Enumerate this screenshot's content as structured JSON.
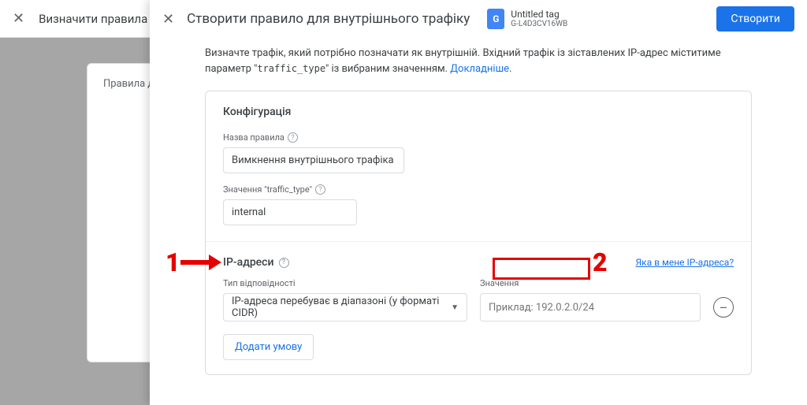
{
  "bg": {
    "close": "✕",
    "title": "Визначити правила д",
    "card_text": "Правила дл"
  },
  "panel": {
    "close": "✕",
    "title": "Створити правило для внутрішнього трафіку",
    "tag_letter": "G",
    "tag_name": "Untitled tag",
    "tag_id": "G-L4D3CV16WB",
    "create": "Створити"
  },
  "desc": {
    "text1": "Визначте трафік, який потрібно позначати як внутрішній. Вхідний трафік із зіставлених IP-адрес міститиме параметр \"",
    "code": "traffic_type",
    "text2": "\" із вибраним значенням. ",
    "link": "Докладніше"
  },
  "card": {
    "config": "Конфігурація",
    "rule_name_label": "Назва правила",
    "rule_name_value": "Вимкнення внутрішнього трафіка",
    "traffic_label": "Значення \"traffic_type\"",
    "traffic_value": "internal",
    "ip_title": "IP-адреси",
    "ip_link": "Яка в мене IP-адреса?",
    "match_label": "Тип відповідності",
    "match_value": "IP-адреса перебуває в діапазоні (у форматі CIDR)",
    "value_label": "Значення",
    "value_placeholder": "Приклад: 192.0.2.0/24",
    "add": "Додати умову"
  },
  "anno": {
    "one": "1",
    "two": "2"
  }
}
